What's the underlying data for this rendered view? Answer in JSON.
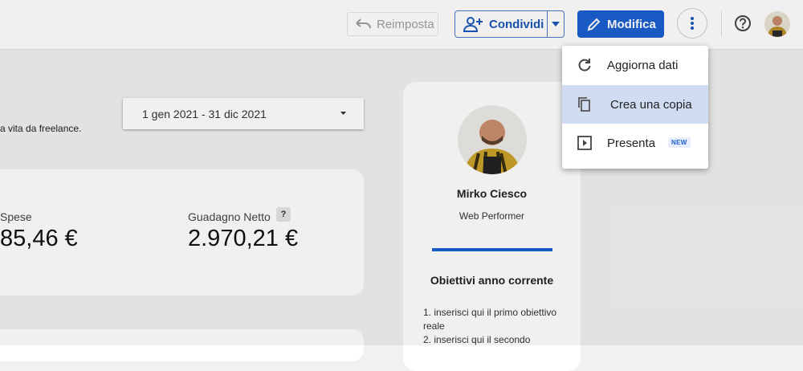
{
  "toolbar": {
    "reset_label": "Reimposta",
    "share_label": "Condividi",
    "edit_label": "Modifica",
    "accent_color": "#1a5fd1"
  },
  "report": {
    "subtitle": "a vita da freelance.",
    "date_range": "1 gen 2021 - 31 dic 2021",
    "kpis": [
      {
        "label": "Spese",
        "value": "85,46 €"
      },
      {
        "label": "Guadagno Netto",
        "value": "2.970,21 €",
        "help": "?"
      }
    ]
  },
  "profile": {
    "name": "Mirko Ciesco",
    "role": "Web Performer",
    "goals_title": "Obiettivi anno corrente",
    "goals": [
      "1. inserisci qui il primo obiettivo reale",
      "2. inserisci qui il secondo"
    ]
  },
  "menu": {
    "items": [
      {
        "label": "Aggiorna dati",
        "icon": "refresh-icon"
      },
      {
        "label": "Crea una copia",
        "icon": "copy-icon",
        "highlighted": true
      },
      {
        "label": "Presenta",
        "icon": "present-icon",
        "badge": "NEW"
      }
    ]
  }
}
